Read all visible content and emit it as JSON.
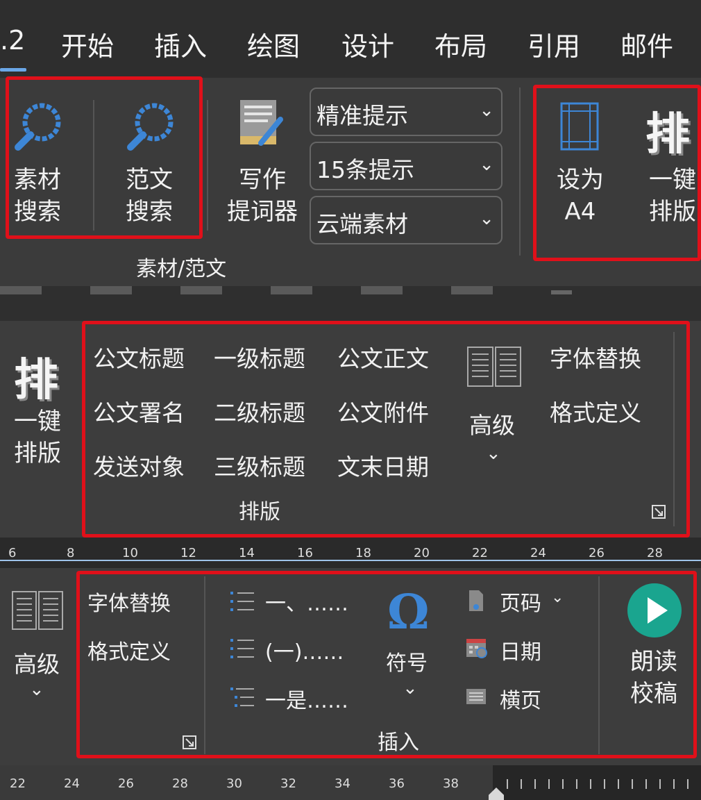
{
  "tabs": [
    ".2",
    "开始",
    "插入",
    "绘图",
    "设计",
    "布局",
    "引用",
    "邮件"
  ],
  "group1": {
    "material_search": [
      "素材",
      "搜索"
    ],
    "essay_search": [
      "范文",
      "搜索"
    ],
    "writer": [
      "写作",
      "提词器"
    ],
    "dropdowns": [
      "精准提示",
      "15条提示",
      "云端素材"
    ],
    "label": "素材/范文",
    "set_a4": [
      "设为",
      "A4"
    ],
    "one_key_icon": "排",
    "one_key": [
      "一键",
      "排版"
    ]
  },
  "group2": {
    "one_key_icon": "排",
    "one_key": [
      "一键",
      "排版"
    ],
    "styles": [
      [
        "公文标题",
        "一级标题",
        "公文正文"
      ],
      [
        "公文署名",
        "二级标题",
        "公文附件"
      ],
      [
        "发送对象",
        "三级标题",
        "文末日期"
      ]
    ],
    "advanced": "高级",
    "font_replace": "字体替换",
    "format_define": "格式定义",
    "label": "排版"
  },
  "ruler1": [
    "6",
    "8",
    "10",
    "12",
    "14",
    "16",
    "18",
    "20",
    "22",
    "24",
    "26",
    "28"
  ],
  "group3": {
    "advanced": "高级",
    "font_replace": "字体替换",
    "format_define": "格式定义",
    "lists": [
      "一、……",
      "(一)……",
      "一是……"
    ],
    "symbol_glyph": "Ω",
    "symbol": "符号",
    "page_number": "页码",
    "date": "日期",
    "landscape": "横页",
    "label": "插入",
    "read_proof": [
      "朗读",
      "校稿"
    ]
  },
  "ruler2": [
    "22",
    "24",
    "26",
    "28",
    "30",
    "32",
    "34",
    "36",
    "38"
  ],
  "colors": {
    "accent_red": "#e0101a",
    "teal": "#1aa58f",
    "blue_icon": "#3d86d6"
  }
}
